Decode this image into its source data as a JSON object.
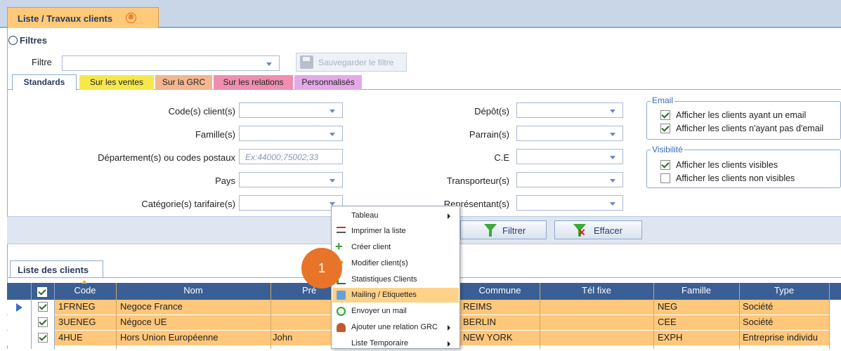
{
  "window": {
    "tab_title": "Liste / Travaux clients",
    "close_glyph": "⊗"
  },
  "filters": {
    "title": "Filtres",
    "filter_label": "Filtre",
    "save_button": "Sauvegarder le filtre",
    "tabs": [
      {
        "label": "Standards",
        "color": "#ffffff"
      },
      {
        "label": "Sur les ventes",
        "color": "#f6e84a"
      },
      {
        "label": "Sur la GRC",
        "color": "#f3b690"
      },
      {
        "label": "Sur les relations",
        "color": "#ee8fb0"
      },
      {
        "label": "Personnalisés",
        "color": "#e4a9e8"
      }
    ],
    "left_fields": [
      {
        "label": "Code(s) client(s)",
        "placeholder": ""
      },
      {
        "label": "Famille(s)",
        "placeholder": ""
      },
      {
        "label": "Département(s) ou codes postaux",
        "placeholder": "Ex:44000;75002;33"
      },
      {
        "label": "Pays",
        "placeholder": ""
      },
      {
        "label": "Catégorie(s) tarifaire(s)",
        "placeholder": ""
      }
    ],
    "right_fields": [
      {
        "label": "Dépôt(s)"
      },
      {
        "label": "Parrain(s)"
      },
      {
        "label": "C.E"
      },
      {
        "label": "Transporteur(s)"
      },
      {
        "label": "Représentant(s)"
      }
    ],
    "email_group": {
      "legend": "Email",
      "options": [
        {
          "label": "Afficher les clients ayant un email",
          "checked": true
        },
        {
          "label": "Afficher les clients n'ayant pas d'email",
          "checked": true
        }
      ]
    },
    "visibility_group": {
      "legend": "Visibilité",
      "options": [
        {
          "label": "Afficher les clients visibles",
          "checked": true
        },
        {
          "label": "Afficher les clients non visibles",
          "checked": false
        }
      ]
    },
    "filter_button": "Filtrer",
    "clear_button": "Effacer"
  },
  "grid": {
    "tab_label": "Liste des clients",
    "columns": [
      "Code",
      "Nom",
      "Pré",
      "Commune",
      "Tél fixe",
      "Famille",
      "Type"
    ],
    "rows": [
      {
        "code": "1FRNEG",
        "nom": "Negoce France",
        "prenom": "",
        "commune": "REIMS",
        "tel": "",
        "famille": "NEG",
        "type": "Société",
        "checked": true,
        "current": true
      },
      {
        "code": "3UENEG",
        "nom": "Négoce UE",
        "prenom": "",
        "commune": "BERLIN",
        "tel": "",
        "famille": "CEE",
        "type": "Société",
        "checked": true,
        "current": false
      },
      {
        "code": "4HUE",
        "nom": "Hors Union Européenne",
        "prenom": "John",
        "commune": "NEW YORK",
        "tel": "",
        "famille": "EXPH",
        "type": "Entreprise individu",
        "checked": true,
        "current": false
      }
    ],
    "row_color": "#ffc77a"
  },
  "context_menu": {
    "items": [
      {
        "label": "Tableau",
        "icon": "none",
        "submenu": true
      },
      {
        "label": "Imprimer la liste",
        "icon": "print-list-icon",
        "submenu": false
      },
      {
        "label": "Créer client",
        "icon": "add-icon",
        "submenu": false
      },
      {
        "label": "Modifier client(s)",
        "icon": "edit-icon",
        "submenu": false
      },
      {
        "label": "Statistiques Clients",
        "icon": "stats-icon",
        "submenu": false
      },
      {
        "label": "Mailing / Etiquettes",
        "icon": "mailing-icon",
        "submenu": false,
        "highlighted": true
      },
      {
        "label": "Envoyer un mail",
        "icon": "send-mail-icon",
        "submenu": false
      },
      {
        "label": "Ajouter une relation GRC",
        "icon": "crm-relation-icon",
        "submenu": true
      },
      {
        "label": "Liste Temporaire",
        "icon": "none",
        "submenu": true
      }
    ]
  },
  "step_badge": "1"
}
